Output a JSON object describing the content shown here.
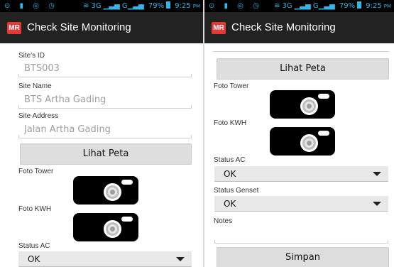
{
  "status_bar": {
    "network": "3G",
    "battery": "79%",
    "time": "9:25",
    "ampm": "PM"
  },
  "app": {
    "title": "Check Site Monitoring",
    "icon_text": "MR",
    "icon_color": "#e53935"
  },
  "form": {
    "site_id_label": "Site's ID",
    "site_id_value": "BTS003",
    "site_name_label": "Site Name",
    "site_name_value": "BTS Artha Gading",
    "site_address_label": "Site Address",
    "site_address_value": "Jalan Artha Gading",
    "map_button": "Lihat Peta",
    "photo_tower_label": "Foto Tower",
    "photo_kwh_label": "Foto KWH",
    "status_ac_label": "Status AC",
    "status_ac_value": "OK",
    "status_genset_label": "Status Genset",
    "status_genset_value": "OK",
    "notes_label": "Notes",
    "notes_value": "",
    "save_button": "Simpan"
  },
  "icons": {
    "camera": "camera-icon",
    "dropdown": "chevron-down-icon",
    "wifi": "wifi-icon",
    "signal": "signal-icon"
  }
}
